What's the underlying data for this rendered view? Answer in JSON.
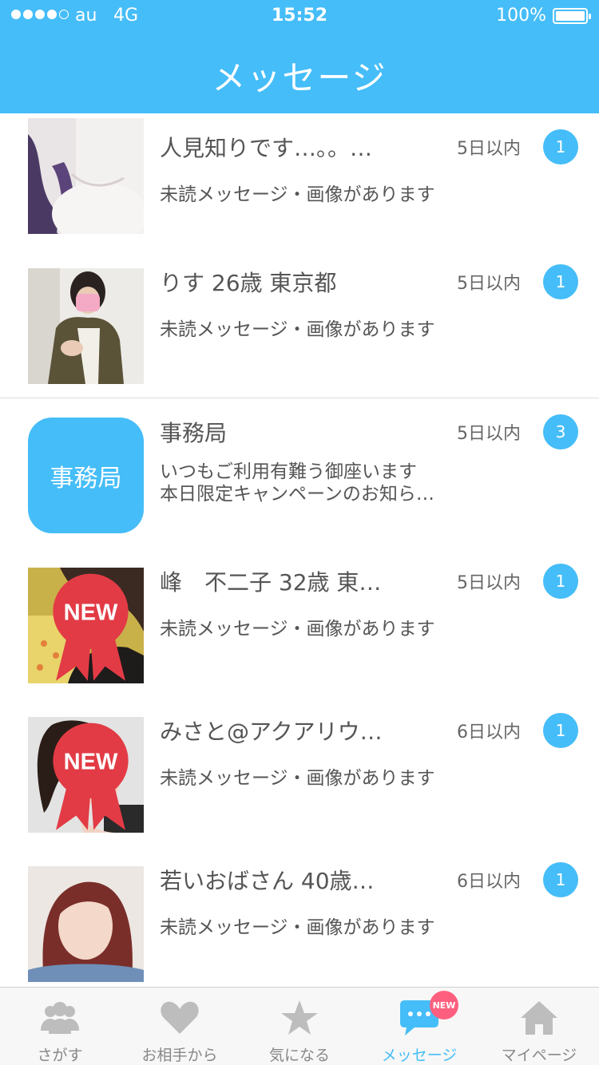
{
  "status_bar": {
    "carrier": "au",
    "network": "4G",
    "time": "15:52",
    "battery": "100%",
    "battery_level": 1.0,
    "signal_bars": 4
  },
  "header": {
    "title": "メッセージ"
  },
  "colors": {
    "accent": "#45bdf8",
    "new_badge": "#ff5f7e"
  },
  "conversations": [
    {
      "name": "人見知りです…。。…",
      "date": "5日以内",
      "unread": "1",
      "preview": "未読メッセージ・画像があります",
      "new": false
    },
    {
      "name": "りす 26歳 東京都",
      "date": "5日以内",
      "unread": "1",
      "preview": "未読メッセージ・画像があります",
      "new": false
    },
    {
      "name": "事務局",
      "date": "5日以内",
      "unread": "3",
      "avatar_text": "事務局",
      "preview_line1": "いつもご利用有難う御座います",
      "preview_line2": "本日限定キャンペーンのお知ら…",
      "new": false
    },
    {
      "name": "峰　不二子 32歳 東…",
      "date": "5日以内",
      "unread": "1",
      "preview": "未読メッセージ・画像があります",
      "new": true
    },
    {
      "name": "みさと@アクアリウ…",
      "date": "6日以内",
      "unread": "1",
      "preview": "未読メッセージ・画像があります",
      "new": true
    },
    {
      "name": "若いおばさん 40歳…",
      "date": "6日以内",
      "unread": "1",
      "preview": "未読メッセージ・画像があります",
      "new": false
    }
  ],
  "tabbar": {
    "items": [
      {
        "label": "さがす",
        "icon": "people-icon"
      },
      {
        "label": "お相手から",
        "icon": "heart-icon"
      },
      {
        "label": "気になる",
        "icon": "star-icon"
      },
      {
        "label": "メッセージ",
        "icon": "chat-bubble-icon",
        "active": true,
        "badge": "NEW"
      },
      {
        "label": "マイページ",
        "icon": "home-icon"
      }
    ]
  }
}
